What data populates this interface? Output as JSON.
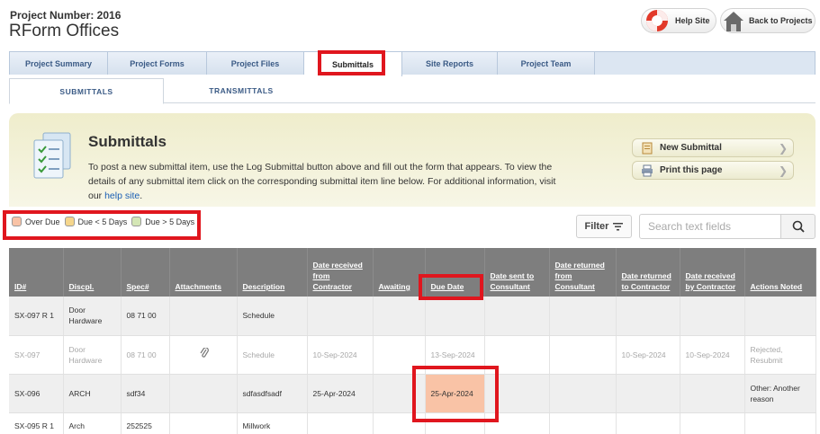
{
  "header": {
    "project_number": "Project Number: 2016",
    "project_name": "RForm Offices",
    "help_label": "Help Site",
    "back_label": "Back to Projects"
  },
  "tabs": [
    "Project Summary",
    "Project Forms",
    "Project Files",
    "Submittals",
    "Site Reports",
    "Project Team"
  ],
  "active_tab": "Submittals",
  "subtabs": [
    "SUBMITTALS",
    "TRANSMITTALS"
  ],
  "panel": {
    "title": "Submittals",
    "text": "To post a new submittal item, use the Log Submittal button above and fill out the form that appears. To view the details of any submittal item click on the corresponding submittal item line below. For additional information, visit our ",
    "link": "help site",
    "text_end": ".",
    "new_submittal": "New Submittal",
    "print_page": "Print this page"
  },
  "legend": [
    {
      "label": "Over Due",
      "color": "#f9c3a6"
    },
    {
      "label": "Due < 5 Days",
      "color": "#f5d68c"
    },
    {
      "label": "Due > 5 Days",
      "color": "#d4e6b5"
    }
  ],
  "filter_label": "Filter",
  "search": {
    "placeholder": "Search text fields",
    "value": ""
  },
  "table": {
    "columns": [
      "ID#",
      "Discpl.",
      "Spec#",
      "Attachments",
      "Description",
      "Date received from Contractor",
      "Awaiting",
      "Due Date",
      "Date sent to Consultant",
      "Date returned from Consultant",
      "Date returned to Contractor",
      "Date received by Contractor",
      "Actions Noted"
    ],
    "rows": [
      {
        "id": "SX-097 R 1",
        "discipline": "Door Hardware",
        "spec": "08 71 00",
        "attachment": false,
        "description": "Schedule",
        "received": "",
        "awaiting": "",
        "due": "",
        "sent": "",
        "returned_from": "",
        "returned_to": "",
        "received_by": "",
        "actions": ""
      },
      {
        "id": "SX-097",
        "discipline": "Door Hardware",
        "spec": "08 71 00",
        "attachment": true,
        "description": "Schedule",
        "received": "10-Sep-2024",
        "awaiting": "",
        "due": "13-Sep-2024",
        "sent": "",
        "returned_from": "",
        "returned_to": "10-Sep-2024",
        "received_by": "10-Sep-2024",
        "actions": "Rejected, Resubmit"
      },
      {
        "id": "SX-096",
        "discipline": "ARCH",
        "spec": "sdf34",
        "attachment": false,
        "description": "sdfasdfsadf",
        "received": "25-Apr-2024",
        "awaiting": "",
        "due": "25-Apr-2024",
        "sent": "",
        "returned_from": "",
        "returned_to": "",
        "received_by": "",
        "actions": "Other: Another reason"
      },
      {
        "id": "SX-095 R 1",
        "discipline": "Arch",
        "spec": "252525",
        "attachment": false,
        "description": "Millwork",
        "received": "",
        "awaiting": "",
        "due": "",
        "sent": "",
        "returned_from": "",
        "returned_to": "",
        "received_by": "",
        "actions": ""
      }
    ]
  }
}
